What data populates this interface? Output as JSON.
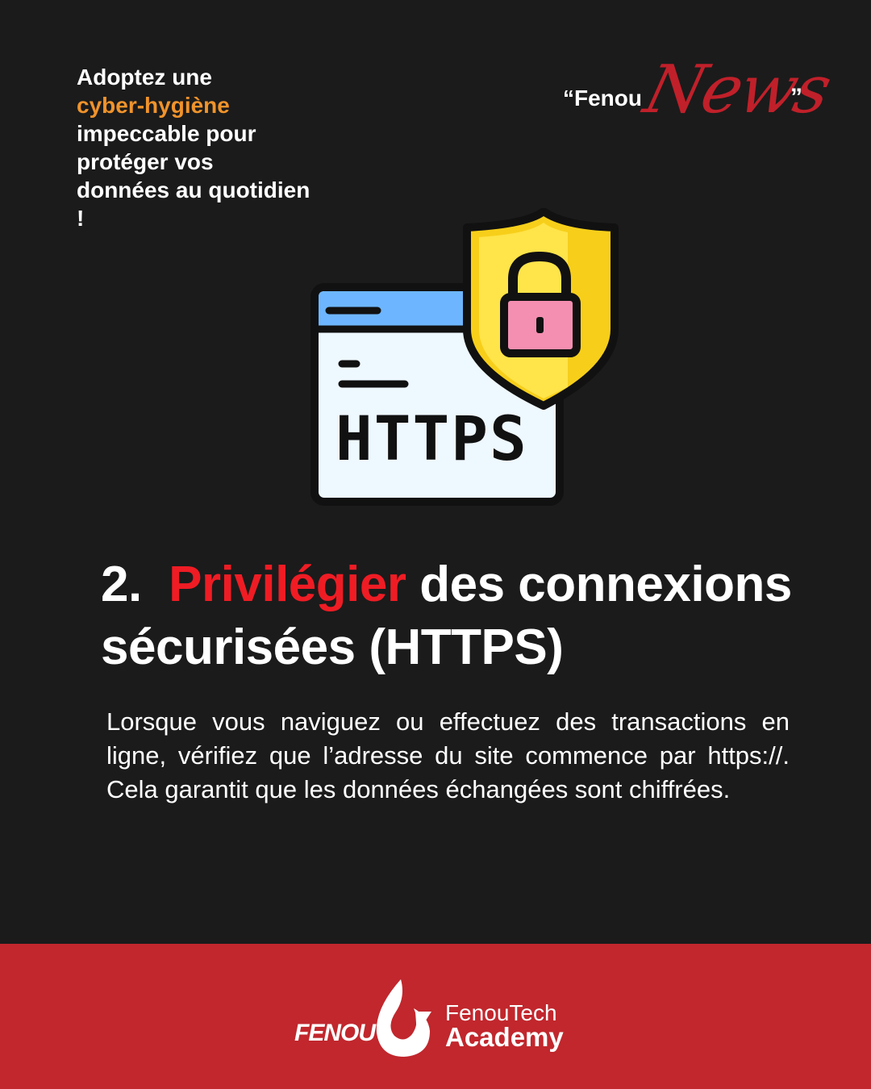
{
  "intro": {
    "line1": "Adoptez une",
    "highlight": "cyber-hygiène",
    "rest": "impeccable pour protéger vos données au quotidien !"
  },
  "brand_quote": {
    "open": "“Fenou",
    "news": "News",
    "close": "”"
  },
  "icon": {
    "text": "HTTPS",
    "name": "https-shield-lock-icon"
  },
  "heading": {
    "number": "2.",
    "highlight": "Privilégier",
    "rest": "des connexions sécurisées (HTTPS)"
  },
  "body": "Lorsque vous naviguez ou effectuez des transactions en ligne, vérifiez que l’adresse du site commence par https://. Cela garantit que les données échangées sont chiffrées.",
  "footer": {
    "logo_text": "FENOU",
    "logo_sub": "Tech",
    "academy_top": "FenouTech",
    "academy_bottom": "Academy"
  },
  "colors": {
    "background": "#1b1b1b",
    "accent_orange": "#f0932b",
    "accent_red": "#ef1c24",
    "footer_red": "#c1272d"
  }
}
